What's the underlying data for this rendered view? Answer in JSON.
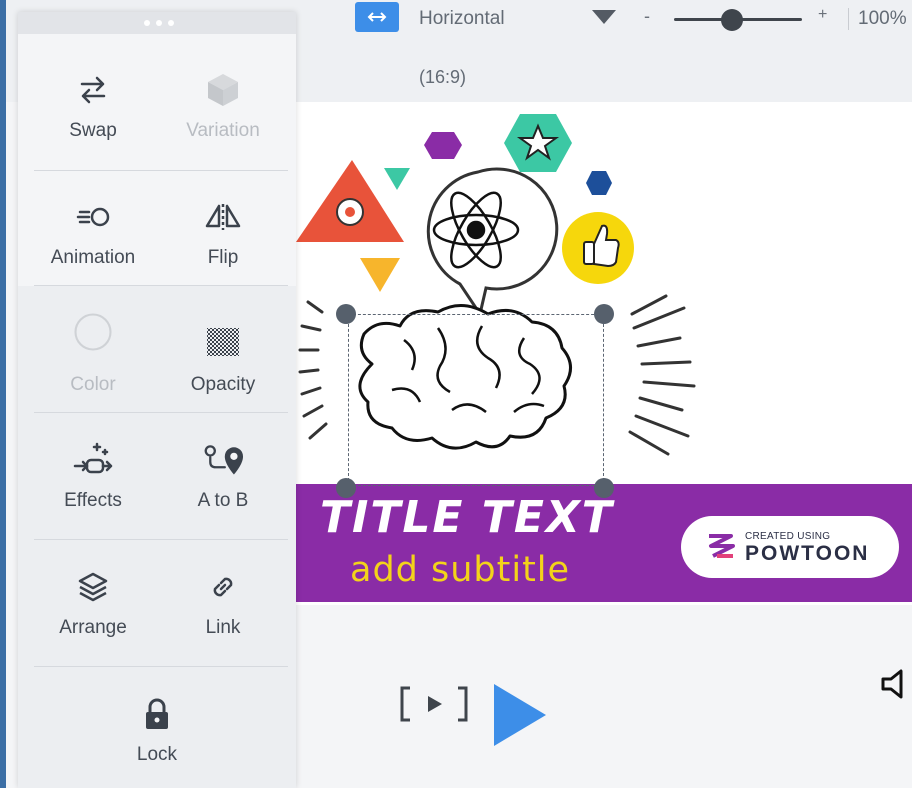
{
  "toolbar": {
    "orientation": "Horizontal",
    "aspect_ratio": "(16:9)",
    "zoom_minus": "-",
    "zoom_plus": "+",
    "zoom_value": "100%",
    "zoom_level": 0.45
  },
  "panel": {
    "tools": [
      {
        "label": "Swap",
        "icon": "swap-icon",
        "enabled": true
      },
      {
        "label": "Variation",
        "icon": "cube-icon",
        "enabled": false
      },
      {
        "label": "Animation",
        "icon": "animation-icon",
        "enabled": true
      },
      {
        "label": "Flip",
        "icon": "flip-icon",
        "enabled": true
      },
      {
        "label": "Color",
        "icon": "color-circle-icon",
        "enabled": false
      },
      {
        "label": "Opacity",
        "icon": "checkerboard-icon",
        "enabled": true
      },
      {
        "label": "Effects",
        "icon": "sparkle-effects-icon",
        "enabled": true
      },
      {
        "label": "A to B",
        "icon": "path-pin-icon",
        "enabled": true
      },
      {
        "label": "Arrange",
        "icon": "layers-icon",
        "enabled": true
      },
      {
        "label": "Link",
        "icon": "chain-link-icon",
        "enabled": true
      },
      {
        "label": "Lock",
        "icon": "padlock-icon",
        "enabled": true
      }
    ]
  },
  "canvas": {
    "title": "TITLE TEXT",
    "subtitle": "add subtitle",
    "badge_small": "CREATED USING",
    "badge_big": "POWTOON",
    "colors": {
      "title_bar": "#8a2ca6",
      "subtitle": "#f3d31a",
      "triangle": "#e8533a",
      "teal": "#3cc8a4",
      "purple": "#8a2ca6",
      "navy": "#1d4f9a",
      "yellow": "#f6d70c",
      "orange": "#f7b52c"
    }
  },
  "accent": "#3d8ee8"
}
